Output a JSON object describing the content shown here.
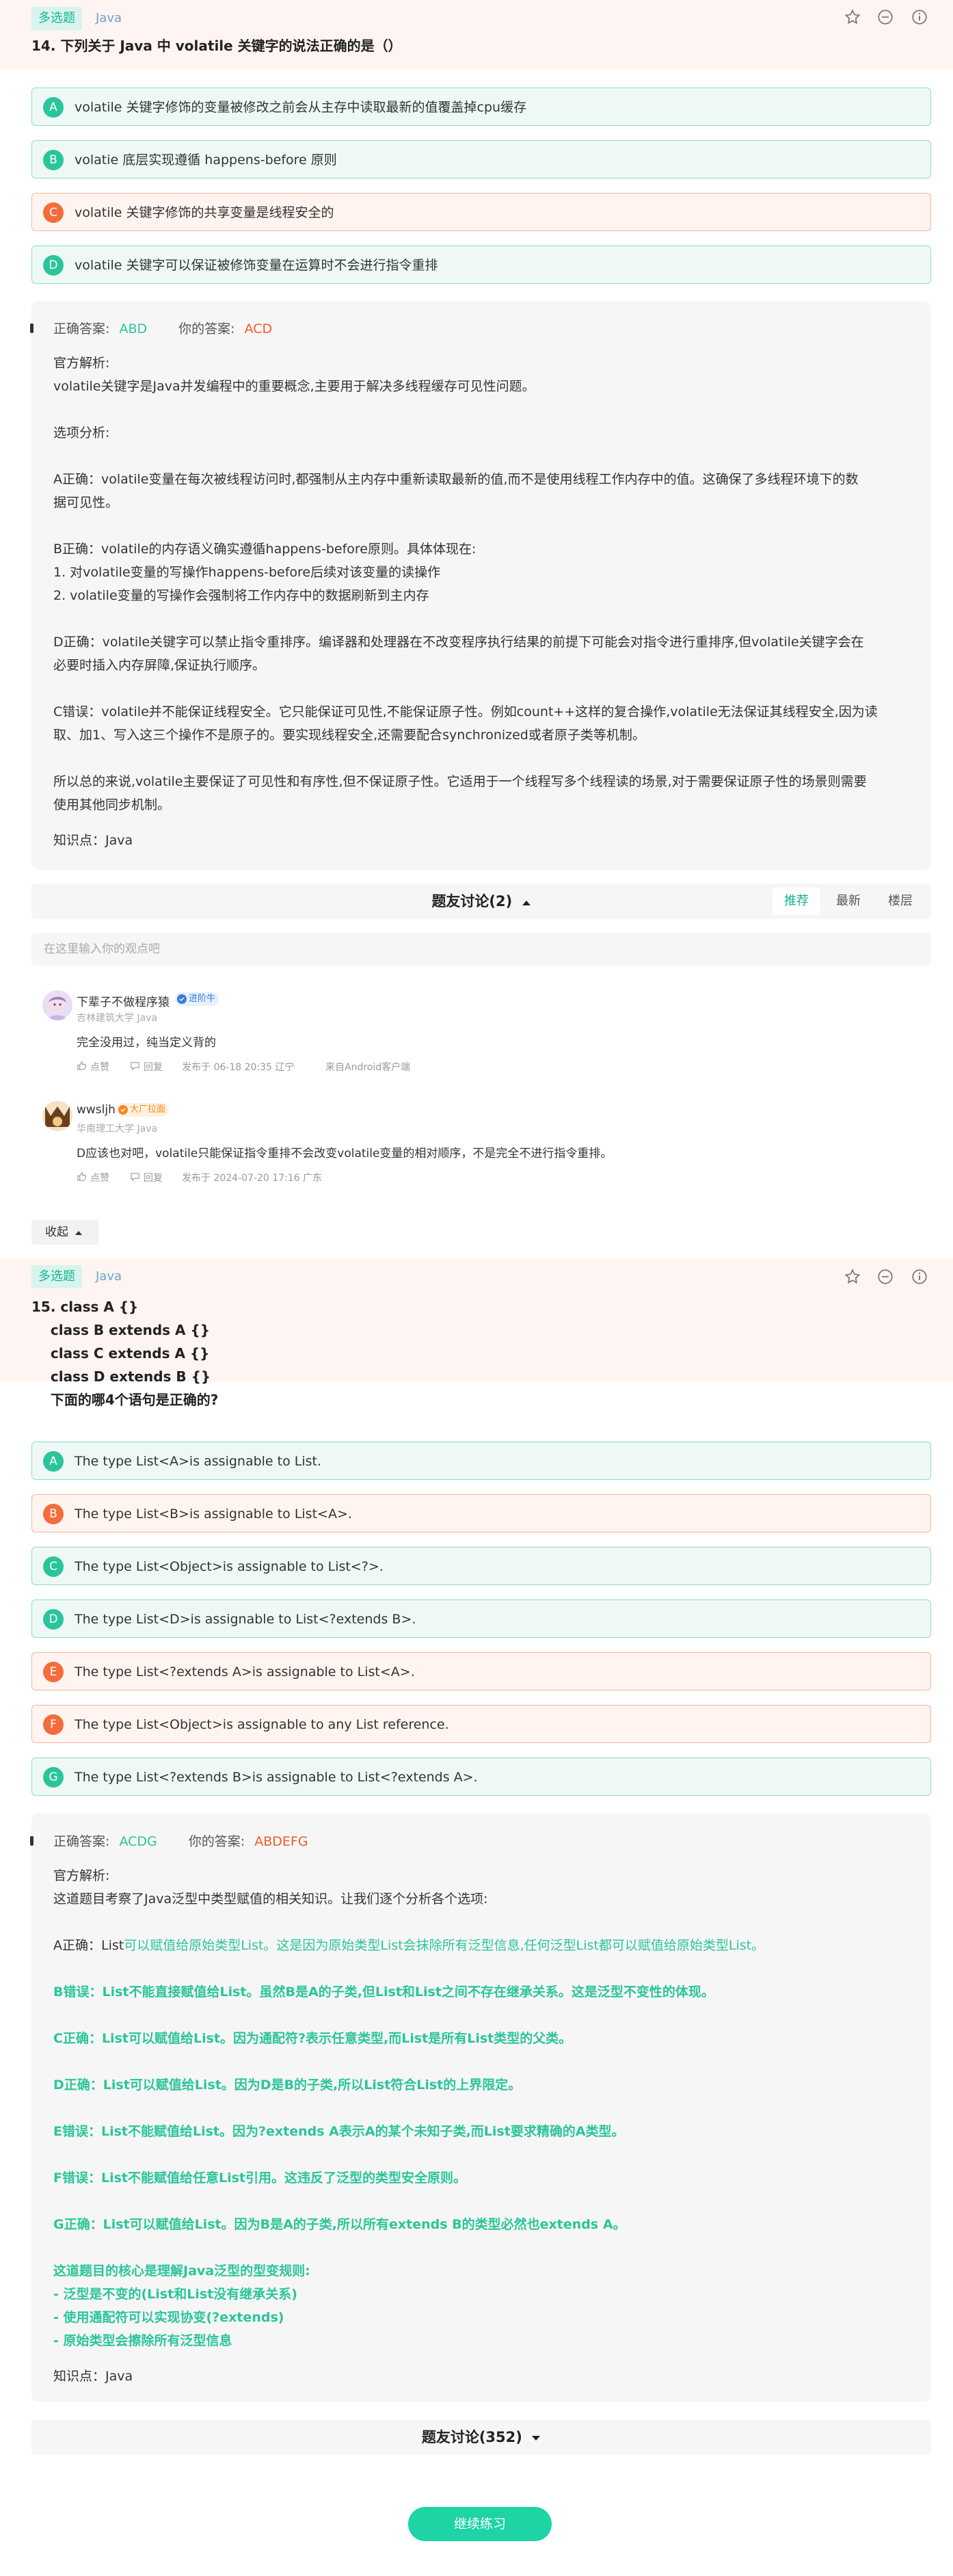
{
  "q14": {
    "type_tag": "多选题",
    "topic_tag": "Java",
    "title": "14. 下列关于 Java 中 volatile 关键字的说法正确的是（）",
    "options": [
      {
        "letter": "A",
        "text": "volatile 关键字修饰的变量被修改之前会从主存中读取最新的值覆盖掉cpu缓存",
        "status": "correct"
      },
      {
        "letter": "B",
        "text": "volatie 底层实现遵循 happens-before 原则",
        "status": "correct"
      },
      {
        "letter": "C",
        "text": "volatile 关键字修饰的共享变量是线程安全的",
        "status": "wrong"
      },
      {
        "letter": "D",
        "text": "volatile 关键字可以保证被修饰变量在运算时不会进行指令重排",
        "status": "correct"
      }
    ],
    "correct_label": "正确答案:",
    "correct_answer": "ABD",
    "your_label": "你的答案:",
    "your_answer": "ACD",
    "analysis": [
      "官方解析:",
      "volatile关键字是Java并发编程中的重要概念,主要用于解决多线程缓存可见性问题。",
      "选项分析:",
      "A正确：volatile变量在每次被线程访问时,都强制从主内存中重新读取最新的值,而不是使用线程工作内存中的值。这确保了多线程环境下的数",
      "据可见性。",
      "B正确：volatile的内存语义确实遵循happens-before原则。具体体现在:",
      "1. 对volatile变量的写操作happens-before后续对该变量的读操作",
      "2. volatile变量的写操作会强制将工作内存中的数据刷新到主内存",
      "D正确：volatile关键字可以禁止指令重排序。编译器和处理器在不改变程序执行结果的前提下可能会对指令进行重排序,但volatile关键字会在",
      "必要时插入内存屏障,保证执行顺序。",
      "C错误：volatile并不能保证线程安全。它只能保证可见性,不能保证原子性。例如count++这样的复合操作,volatile无法保证其线程安全,因为读",
      "取、加1、写入这三个操作不是原子的。要实现线程安全,还需要配合synchronized或者原子类等机制。",
      "所以总的来说,volatile主要保证了可见性和有序性,但不保证原子性。它适用于一个线程写多个线程读的场景,对于需要保证原子性的场景则需要",
      "使用其他同步机制。"
    ],
    "knowledge": "知识点：Java",
    "discussion_title": "题友讨论(2)",
    "sort_options": [
      "推荐",
      "最新",
      "楼层"
    ],
    "comment_placeholder": "在这里输入你的观点吧",
    "comments": [
      {
        "name": "下辈子不做程序猿",
        "badge": "进阶牛",
        "school": "吉林建筑大学 Java",
        "text": "完全没用过，纯当定义背的",
        "like": "点赞",
        "reply": "回复",
        "time": "发布于 06-18 20:35 辽宁",
        "source": "来自Android客户端"
      },
      {
        "name": "wwsljh",
        "badge": "大厂拉面",
        "school": "华南理工大学 Java",
        "text": "D应该也对吧，volatile只能保证指令重排不会改变volatile变量的相对顺序，不是完全不进行指令重排。",
        "like": "点赞",
        "reply": "回复",
        "time": "发布于 2024-07-20 17:16 广东",
        "source": ""
      }
    ],
    "collapse_label": "收起"
  },
  "q15": {
    "type_tag": "多选题",
    "topic_tag": "Java",
    "title_lines": [
      "15. class A {}",
      "    class B extends A {}",
      "    class C extends A {}",
      "    class D extends B {}",
      "    下面的哪4个语句是正确的?"
    ],
    "options": [
      {
        "letter": "A",
        "text": "The type List<A>is assignable to List.",
        "status": "correct"
      },
      {
        "letter": "B",
        "text": "The type List<B>is assignable to List<A>.",
        "status": "wrong"
      },
      {
        "letter": "C",
        "text": "The type List<Object>is assignable to List<?>.",
        "status": "correct"
      },
      {
        "letter": "D",
        "text": "The type List<D>is assignable to List<?extends B>.",
        "status": "correct"
      },
      {
        "letter": "E",
        "text": "The type List<?extends A>is assignable to List<A>.",
        "status": "wrong"
      },
      {
        "letter": "F",
        "text": "The type List<Object>is assignable to any List reference.",
        "status": "wrong"
      },
      {
        "letter": "G",
        "text": "The type List<?extends B>is assignable to List<?extends A>.",
        "status": "correct"
      }
    ],
    "correct_label": "正确答案:",
    "correct_answer": "ACDG",
    "your_label": "你的答案:",
    "your_answer": "ABDEFG",
    "analysis_intro": [
      "官方解析:",
      "这道题目考察了Java泛型中类型赋值的相关知识。让我们逐个分析各个选项:"
    ],
    "a_prefix": "A正确：List",
    "a_rest": "可以赋值给原始类型List。这是因为原始类型List会抹除所有泛型信息,任何泛型List都可以赋值给原始类型List。",
    "analysis_green": [
      "B错误：List不能直接赋值给List。虽然B是A的子类,但List和List之间不存在继承关系。这是泛型不变性的体现。",
      "C正确：List可以赋值给List。因为通配符?表示任意类型,而List是所有List类型的父类。",
      "D正确：List可以赋值给List。因为D是B的子类,所以List符合List的上界限定。",
      "E错误：List不能赋值给List。因为?extends A表示A的某个未知子类,而List要求精确的A类型。",
      "F错误：List不能赋值给任意List引用。这违反了泛型的类型安全原则。",
      "G正确：List可以赋值给List。因为B是A的子类,所以所有extends B的类型必然也extends A。"
    ],
    "analysis_summary": [
      "这道题目的核心是理解Java泛型的型变规则:",
      "- 泛型是不变的(List和List没有继承关系)",
      "- 使用通配符可以实现协变(?extends)",
      "- 原始类型会擦除所有泛型信息"
    ],
    "knowledge": "知识点：Java",
    "discussion_title": "题友讨论(352)"
  },
  "continue_label": "继续练习",
  "colors": {
    "accent": "#19b394",
    "correct": "#2bc59a",
    "wrong": "#f56c3c",
    "header_bg": "#fef4f1"
  },
  "icons": [
    "star-icon",
    "minus-circle-icon",
    "info-icon",
    "chevron-up-icon",
    "chevron-down-icon",
    "like-icon",
    "comment-icon",
    "verified-icon"
  ]
}
